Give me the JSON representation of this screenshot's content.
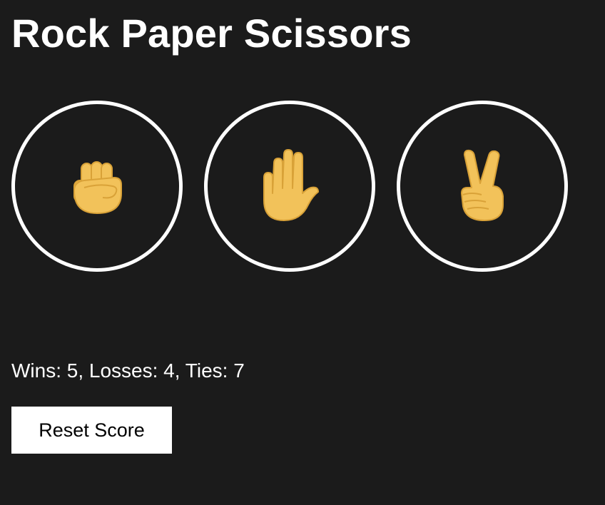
{
  "title": "Rock Paper Scissors",
  "choices": [
    {
      "name": "rock",
      "icon": "raised-fist-icon"
    },
    {
      "name": "paper",
      "icon": "raised-hand-icon"
    },
    {
      "name": "scissors",
      "icon": "victory-hand-icon"
    }
  ],
  "score_text": "Wins: 5, Losses: 4, Ties: 7",
  "reset_label": "Reset Score",
  "colors": {
    "background": "#1b1b1b",
    "text": "#ffffff",
    "circle_border": "#ffffff",
    "skin": "#f2c25a",
    "skin_line": "#d9a238",
    "button_bg": "#ffffff",
    "button_text": "#000000"
  }
}
